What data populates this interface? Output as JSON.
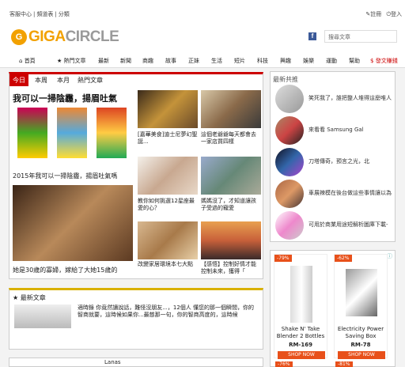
{
  "topbar": {
    "links": [
      "客服中心",
      "|",
      "頻道表",
      "|",
      "分類"
    ],
    "register": "註冊",
    "login": "登入"
  },
  "logo": {
    "mark": "G",
    "giga": "GIGA",
    "circle": "CIRCLE"
  },
  "search": {
    "placeholder": "搜尋文章"
  },
  "nav": [
    {
      "label": "首頁",
      "icon": "home-icon"
    },
    {
      "label": "熱門文章",
      "icon": "star-icon"
    },
    {
      "label": "最新"
    },
    {
      "label": "新聞"
    },
    {
      "label": "商趣"
    },
    {
      "label": "故事"
    },
    {
      "label": "正妹"
    },
    {
      "label": "生活"
    },
    {
      "label": "短片"
    },
    {
      "label": "科技"
    },
    {
      "label": "興趣"
    },
    {
      "label": "娛樂"
    },
    {
      "label": "運動"
    },
    {
      "label": "幫助"
    },
    {
      "label": "發文賺錢"
    }
  ],
  "tabs": [
    "今日",
    "本周",
    "本月",
    "熱門文章"
  ],
  "articles": {
    "big": {
      "caption": "2015年我可以一掃陰霾，揚眉吐氣嗎",
      "banner": "我可以一掃陰霾，揚眉吐氣"
    },
    "big2": {
      "caption": "她是30歲的寡婦，嫁給了大她15歲的"
    },
    "a1": {
      "caption": "[嘉華美食]迪士尼夢幻聖誕..."
    },
    "a2": {
      "caption": "這個老爺爺每天都會去一家店買四樣"
    },
    "a3": {
      "caption": "教你如何挑選12星座最愛的心？"
    },
    "a4": {
      "caption": "媽媽沒了，才知道讓孩子受過的寵愛"
    },
    "a5": {
      "caption": "改變家居環境本七大點"
    },
    "a6": {
      "caption": "【感悟】控制好情才能控制未來，獲得「"
    }
  },
  "latest": {
    "title": "最新文章",
    "text": "適時錄 你竟然讀說話，難怪沒朋友...，12個人 懂您的那一個瞬間，你的智商就要，這時候如果你...最慈那一句，你的智商高度的，這時候"
  },
  "sidebar": {
    "title": "最新共推",
    "items": [
      "笑死我了，誰把整人堆得這麼唯人",
      "來看看 Samsung Gal",
      "刀塔傳奇，預言之光，北",
      "車展辣模在後台做這些事情讓以為",
      "可用於商業用途短解析圖庫下載-"
    ]
  },
  "ads": [
    {
      "badge": "-79%",
      "name": "Shake N' Take Blender 2 Bottles",
      "price": "RM-169",
      "btn": "SHOP NOW"
    },
    {
      "badge": "-62%",
      "name": "Electricity Power Saving Box",
      "price": "RM-78",
      "btn": "SHOP NOW"
    }
  ],
  "ads_bottom": {
    "badge1": "-76%",
    "badge2": "-81%"
  },
  "bottom": {
    "label": "Lanas"
  }
}
